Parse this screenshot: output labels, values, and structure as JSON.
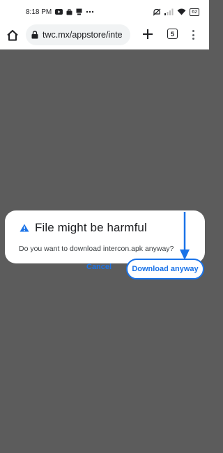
{
  "status_bar": {
    "time": "8:18 PM",
    "left_icons": [
      "youtube-icon",
      "briefcase-icon",
      "download-icon",
      "more-dots-icon"
    ],
    "right_icons": [
      "mute-icon",
      "signal-icon",
      "wifi-icon"
    ],
    "battery": "62"
  },
  "browser": {
    "url": "twc.mx/appstore/inte",
    "tab_count": "5",
    "icons": [
      "home-icon",
      "lock-icon",
      "plus-icon",
      "tab-switcher-icon",
      "overflow-menu-icon"
    ]
  },
  "dialog": {
    "title": "File might be harmful",
    "message": "Do you want to download intercon.apk anyway?",
    "cancel_label": "Cancel",
    "download_label": "Download anyway",
    "warning_icon": "warning-triangle-icon"
  },
  "colors": {
    "accent": "#1a73e8",
    "scrim": "#5c5c5c",
    "dialog_bg": "#ffffff"
  }
}
